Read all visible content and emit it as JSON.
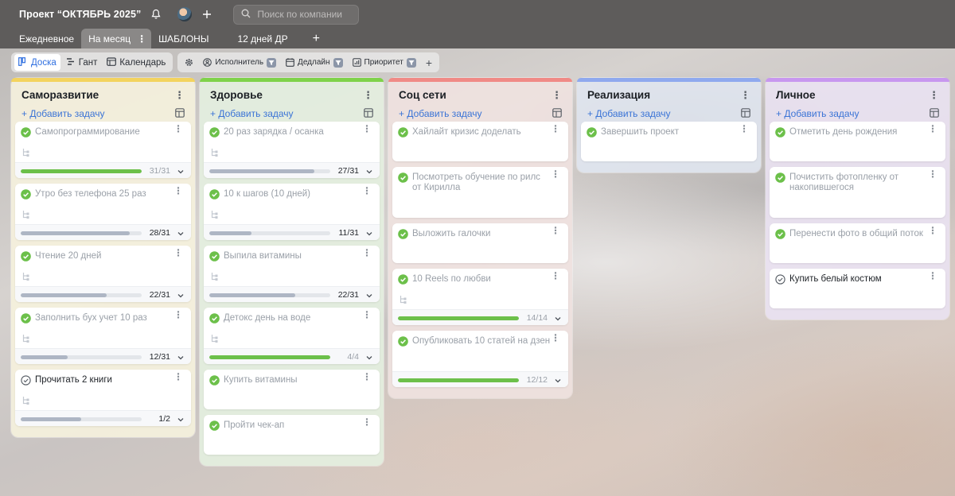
{
  "header": {
    "project_title": "Проект “ОКТЯБРЬ 2025”",
    "search_placeholder": "Поиск по компании"
  },
  "tabs": [
    {
      "label": "Ежедневное",
      "active": false
    },
    {
      "label": "На месяц",
      "active": true
    },
    {
      "label": "ШАБЛОНЫ",
      "active": false
    },
    {
      "label": "12 дней ДР",
      "active": false
    }
  ],
  "views": [
    {
      "label": "Доска",
      "active": true,
      "icon": "board-icon"
    },
    {
      "label": "Гант",
      "active": false,
      "icon": "gantt-icon"
    },
    {
      "label": "Календарь",
      "active": false,
      "icon": "calendar-icon"
    }
  ],
  "filters": [
    {
      "label": "Исполнитель",
      "icon": "person-icon"
    },
    {
      "label": "Дедлайн",
      "icon": "calendar-icon"
    },
    {
      "label": "Приоритет",
      "icon": "bars-icon"
    }
  ],
  "add_task_label": "+ Добавить задачу",
  "colors": {
    "green": "#6cc04a",
    "blue_link": "#3b74d6",
    "header_bg": "#5e5c5b"
  },
  "columns": [
    {
      "title": "Саморазвитие",
      "stripe": "#f3d35e",
      "bg": "rgba(246,242,222,0.9)",
      "cards": [
        {
          "title": "Самопрограммирование",
          "done": true,
          "subtasks": true,
          "progress": {
            "text": "31/31",
            "ratio": 1.0,
            "color": "green",
            "muted": true
          }
        },
        {
          "title": "Утро без телефона 25 раз",
          "done": true,
          "subtasks": true,
          "progress": {
            "text": "28/31",
            "ratio": 0.9,
            "color": "gray",
            "muted": false
          }
        },
        {
          "title": "Чтение 20 дней",
          "done": true,
          "subtasks": true,
          "progress": {
            "text": "22/31",
            "ratio": 0.71,
            "color": "gray",
            "muted": false
          }
        },
        {
          "title": "Заполнить бух учет 10 раз",
          "done": true,
          "subtasks": true,
          "progress": {
            "text": "12/31",
            "ratio": 0.39,
            "color": "gray",
            "muted": false
          }
        },
        {
          "title": "Прочитать 2 книги",
          "done": false,
          "subtasks": true,
          "progress": {
            "text": "1/2",
            "ratio": 0.5,
            "color": "gray",
            "muted": false
          }
        }
      ]
    },
    {
      "title": "Здоровье",
      "stripe": "#7fd24a",
      "bg": "rgba(228,240,224,0.9)",
      "cards": [
        {
          "title": "20 раз зарядка / осанка",
          "done": true,
          "subtasks": true,
          "progress": {
            "text": "27/31",
            "ratio": 0.87,
            "color": "gray",
            "muted": false
          }
        },
        {
          "title": "10 к шагов (10 дней)",
          "done": true,
          "subtasks": true,
          "progress": {
            "text": "11/31",
            "ratio": 0.35,
            "color": "gray",
            "muted": false
          }
        },
        {
          "title": "Выпила витамины",
          "done": true,
          "subtasks": true,
          "progress": {
            "text": "22/31",
            "ratio": 0.71,
            "color": "gray",
            "muted": false
          }
        },
        {
          "title": "Детокс день на воде",
          "done": true,
          "subtasks": true,
          "progress": {
            "text": "4/4",
            "ratio": 1.0,
            "color": "green",
            "muted": true
          }
        },
        {
          "title": "Купить витамины",
          "done": true,
          "subtasks": false,
          "progress": null
        },
        {
          "title": "Пройти чек-ап",
          "done": true,
          "subtasks": false,
          "progress": null
        }
      ]
    },
    {
      "title": "Соц сети",
      "stripe": "#f08a86",
      "bg": "rgba(240,226,224,0.9)",
      "cards": [
        {
          "title": "Хайлайт кризис доделать",
          "done": true,
          "subtasks": false,
          "progress": null
        },
        {
          "title": "Посмотреть обучение по рилс от Кирилла",
          "done": true,
          "subtasks": false,
          "progress": null
        },
        {
          "title": "Выложить галочки",
          "done": true,
          "subtasks": false,
          "progress": null
        },
        {
          "title": "10 Reels по любви",
          "done": true,
          "subtasks": true,
          "progress": {
            "text": "14/14",
            "ratio": 1.0,
            "color": "green",
            "muted": true
          }
        },
        {
          "title": "Опубликовать 10 статей на дзен",
          "done": true,
          "subtasks": false,
          "progress": {
            "text": "12/12",
            "ratio": 1.0,
            "color": "green",
            "muted": true
          }
        }
      ]
    },
    {
      "title": "Реализация",
      "stripe": "#8fa9ee",
      "bg": "rgba(224,230,240,0.9)",
      "cards": [
        {
          "title": "Завершить проект",
          "done": true,
          "subtasks": false,
          "progress": null
        }
      ]
    },
    {
      "title": "Личное",
      "stripe": "#c897ef",
      "bg": "rgba(234,226,242,0.9)",
      "cards": [
        {
          "title": "Отметить день рождения",
          "done": true,
          "subtasks": false,
          "progress": null
        },
        {
          "title": "Почистить фотопленку от накопившегося",
          "done": true,
          "subtasks": false,
          "progress": null
        },
        {
          "title": "Перенести фото в общий поток",
          "done": true,
          "subtasks": false,
          "progress": null
        },
        {
          "title": "Купить белый костюм",
          "done": false,
          "subtasks": false,
          "progress": null
        }
      ]
    }
  ]
}
